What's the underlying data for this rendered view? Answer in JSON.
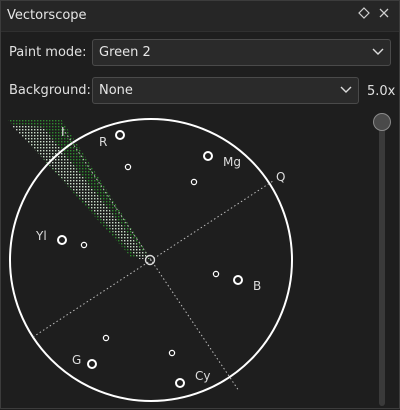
{
  "window": {
    "title": "Vectorscope"
  },
  "titlebar": {
    "float_icon": "diamond-icon",
    "close_icon": "close-icon"
  },
  "controls": {
    "paint_mode": {
      "label": "Paint mode:",
      "value": "Green 2"
    },
    "background": {
      "label": "Background:",
      "value": "None"
    },
    "zoom": "5.0x"
  },
  "scope_labels": {
    "i": "I",
    "q": "Q",
    "r": "R",
    "mg": "Mg",
    "yl": "Yl",
    "b": "B",
    "g": "G",
    "cy": "Cy"
  },
  "colors": {
    "trace": "#2e8a2e",
    "graticule": "#ffffff",
    "background": "#1e1e1e"
  }
}
